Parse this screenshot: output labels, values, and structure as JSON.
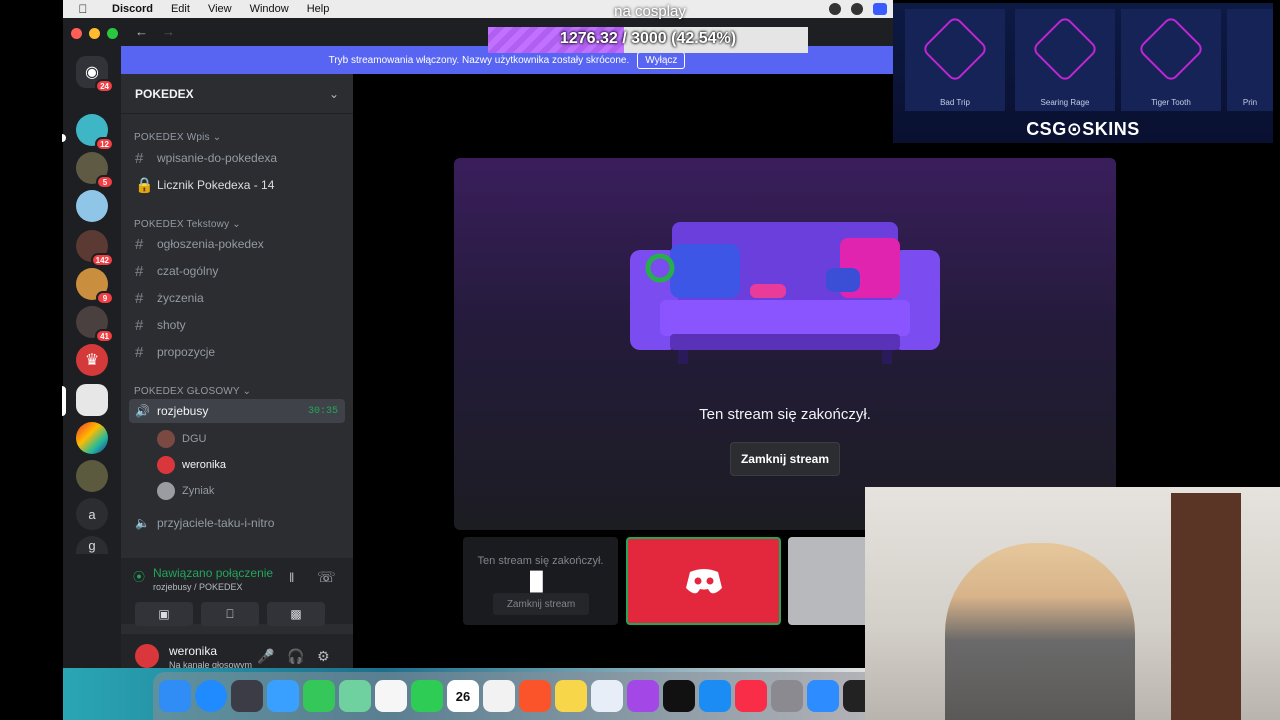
{
  "menubar": {
    "app_name": "Discord",
    "items": [
      "Edit",
      "View",
      "Window",
      "Help"
    ]
  },
  "obs_overlay": {
    "title": "na cosplay",
    "progress_text": "1276.32 / 3000 (42.54%)",
    "progress_fraction": 0.4254
  },
  "banner": {
    "text": "Tryb streamowania włączony. Nazwy użytkownika zostały skrócone.",
    "button": "Wyłącz"
  },
  "rail": {
    "badges": [
      "24",
      "12",
      "5",
      "142",
      "9",
      "41"
    ],
    "letters": [
      "a",
      "g"
    ]
  },
  "server": {
    "name": "POKEDEX",
    "categories": [
      {
        "name": "POKEDEX Wpis",
        "channels": [
          {
            "icon": "hash",
            "name": "wpisanie-do-pokedexa"
          },
          {
            "icon": "lock",
            "name": "Licznik Pokedexa - 14"
          }
        ]
      },
      {
        "name": "POKEDEX Tekstowy",
        "channels": [
          {
            "icon": "hash",
            "name": "ogłoszenia-pokedex"
          },
          {
            "icon": "hash",
            "name": "czat-ogólny"
          },
          {
            "icon": "hash",
            "name": "życzenia"
          },
          {
            "icon": "hash",
            "name": "shoty"
          },
          {
            "icon": "hash",
            "name": "propozycje"
          }
        ]
      },
      {
        "name": "POKEDEX GŁOSOWY",
        "channels": [
          {
            "icon": "speaker",
            "name": "rozjebusy",
            "timer": "30:35"
          },
          {
            "icon": "speaker",
            "name": "przyjaciele-taku-i-nitro"
          }
        ]
      }
    ],
    "voice_users": [
      "DGU",
      "weronika",
      "Zyniak"
    ]
  },
  "voice_panel": {
    "status": "Nawiązano połączenie",
    "location": "rozjebusy / POKEDEX"
  },
  "user_panel": {
    "name": "weronika",
    "status": "Na kanale głosowym"
  },
  "stream": {
    "ended_text": "Ten stream się zakończył.",
    "close_button": "Zamknij stream",
    "thumb_text": "Ten stream się zakończył.",
    "thumb_button": "Zamknij stream"
  },
  "csgo_skins": {
    "logo": "CSG⊙SKINS",
    "items": [
      "Bad Trip",
      "Searing Rage",
      "Tiger Tooth",
      "Prin"
    ]
  },
  "dock": {
    "calendar_day": "26"
  }
}
